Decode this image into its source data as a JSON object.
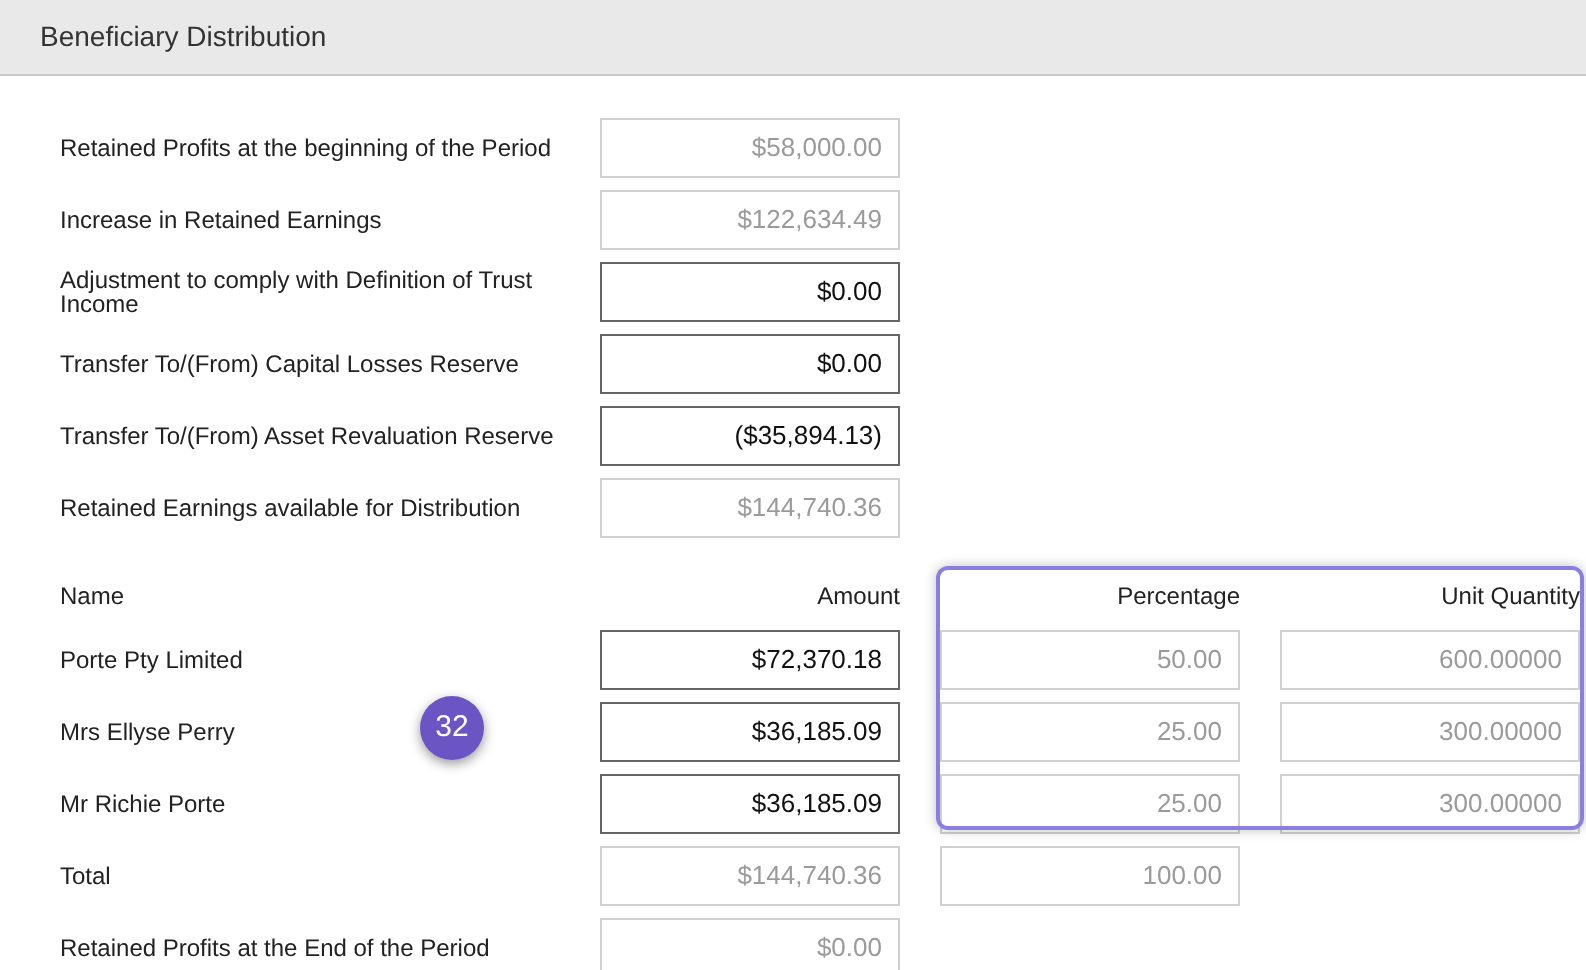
{
  "panel": {
    "title": "Beneficiary Distribution"
  },
  "summary_rows": [
    {
      "label": "Retained Profits at the beginning of the Period",
      "value": "$58,000.00",
      "editable": false
    },
    {
      "label": "Increase in Retained Earnings",
      "value": "$122,634.49",
      "editable": false
    },
    {
      "label": "Adjustment to comply with Definition of Trust Income",
      "value": "$0.00",
      "editable": true
    },
    {
      "label": "Transfer To/(From) Capital Losses Reserve",
      "value": "$0.00",
      "editable": true
    },
    {
      "label": "Transfer To/(From) Asset Revaluation Reserve",
      "value": "($35,894.13)",
      "editable": true
    },
    {
      "label": "Retained Earnings available for Distribution",
      "value": "$144,740.36",
      "editable": false
    }
  ],
  "beneficiaries": {
    "columns": [
      "Name",
      "Amount",
      "Percentage",
      "Unit Quantity"
    ],
    "rows": [
      {
        "name": "Porte Pty Limited",
        "fields": [
          {
            "value": "$72,370.18",
            "editable": true
          },
          {
            "value": "50.00",
            "editable": false
          },
          {
            "value": "600.00000",
            "editable": false
          }
        ]
      },
      {
        "name": "Mrs Ellyse Perry",
        "fields": [
          {
            "value": "$36,185.09",
            "editable": true
          },
          {
            "value": "25.00",
            "editable": false
          },
          {
            "value": "300.00000",
            "editable": false
          }
        ]
      },
      {
        "name": "Mr Richie Porte",
        "fields": [
          {
            "value": "$36,185.09",
            "editable": true
          },
          {
            "value": "25.00",
            "editable": false
          },
          {
            "value": "300.00000",
            "editable": false
          }
        ]
      },
      {
        "name": "Total",
        "fields": [
          {
            "value": "$144,740.36",
            "editable": false
          },
          {
            "value": "100.00",
            "editable": false
          }
        ]
      },
      {
        "name": "Retained Profits at the End of the Period",
        "fields": [
          {
            "value": "$0.00",
            "editable": false
          }
        ]
      }
    ]
  },
  "step_badge": {
    "text": "32"
  }
}
